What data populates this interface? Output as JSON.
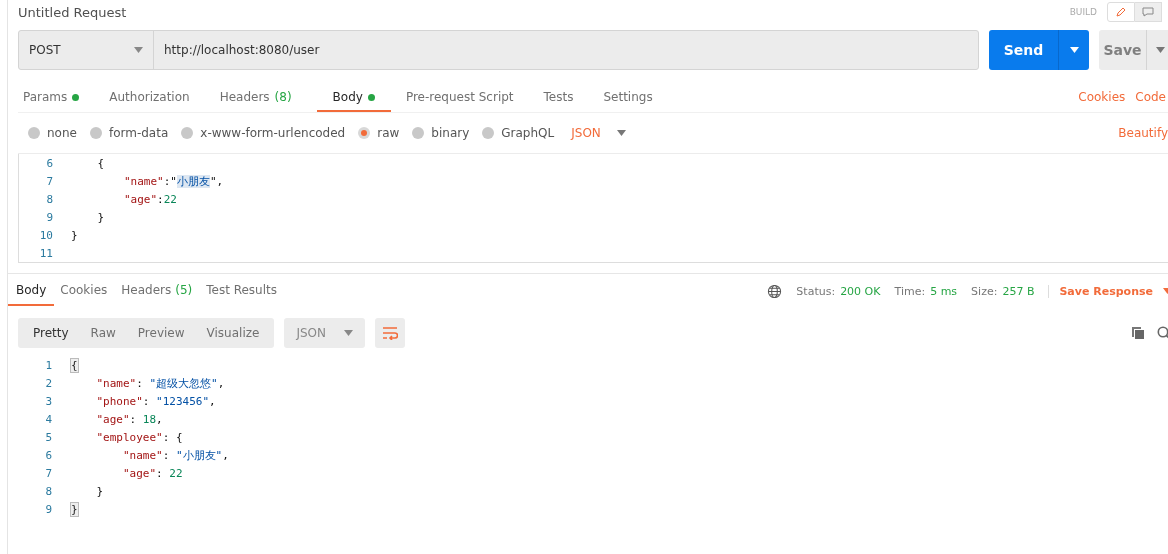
{
  "header": {
    "title": "Untitled Request",
    "mode_label": "BUILD"
  },
  "request": {
    "method": "POST",
    "url": "http://localhost:8080/user",
    "send": "Send",
    "save": "Save"
  },
  "request_tabs": [
    {
      "label": "Params",
      "dot": true,
      "selected": false
    },
    {
      "label": "Authorization",
      "dot": false,
      "selected": false
    },
    {
      "label": "Headers",
      "badge": "(8)",
      "dot": false,
      "selected": false
    },
    {
      "label": "Body",
      "dot": true,
      "selected": true
    },
    {
      "label": "Pre-request Script",
      "dot": false,
      "selected": false
    },
    {
      "label": "Tests",
      "dot": false,
      "selected": false
    },
    {
      "label": "Settings",
      "dot": false,
      "selected": false
    }
  ],
  "request_links": [
    "Cookies",
    "Code"
  ],
  "body_types": [
    {
      "label": "none",
      "selected": false
    },
    {
      "label": "form-data",
      "selected": false
    },
    {
      "label": "x-www-form-urlencoded",
      "selected": false
    },
    {
      "label": "raw",
      "selected": true
    },
    {
      "label": "binary",
      "selected": false
    },
    {
      "label": "GraphQL",
      "selected": false
    }
  ],
  "body_format": "JSON",
  "beautify": "Beautify",
  "request_code": [
    {
      "number": "6",
      "tokens": [
        {
          "kind": "punct",
          "text": "    {"
        }
      ]
    },
    {
      "number": "7",
      "tokens": [
        {
          "kind": "key",
          "text": "        \"name\""
        },
        {
          "kind": "punct",
          "text": ":\""
        },
        {
          "kind": "selected-string",
          "text": "小朋友"
        },
        {
          "kind": "punct",
          "text": "\","
        }
      ]
    },
    {
      "number": "8",
      "tokens": [
        {
          "kind": "key",
          "text": "        \"age\""
        },
        {
          "kind": "punct",
          "text": ":"
        },
        {
          "kind": "number",
          "text": "22"
        }
      ]
    },
    {
      "number": "9",
      "tokens": [
        {
          "kind": "punct",
          "text": "    }"
        }
      ]
    },
    {
      "number": "10",
      "tokens": [
        {
          "kind": "punct",
          "text": "}"
        }
      ]
    },
    {
      "number": "11"
    }
  ],
  "response_tabs": [
    {
      "label": "Body",
      "selected": true
    },
    {
      "label": "Cookies",
      "selected": false
    },
    {
      "label": "Headers",
      "badge": "(5)",
      "selected": false
    },
    {
      "label": "Test Results",
      "selected": false
    }
  ],
  "response_stats": [
    {
      "label": "Status:",
      "value": "200 OK"
    },
    {
      "label": "Time:",
      "value": "5 ms"
    },
    {
      "label": "Size:",
      "value": "257 B"
    }
  ],
  "save_response": "Save Response",
  "view_modes": [
    {
      "label": "Pretty",
      "selected": true
    },
    {
      "label": "Raw",
      "selected": false
    },
    {
      "label": "Preview",
      "selected": false
    },
    {
      "label": "Visualize",
      "selected": false
    }
  ],
  "response_format": "JSON",
  "response_code": [
    {
      "number": "1",
      "tokens": [
        {
          "kind": "matched-bracket",
          "text": "{"
        }
      ]
    },
    {
      "number": "2",
      "tokens": [
        {
          "kind": "key",
          "text": "    \"name\""
        },
        {
          "kind": "punct",
          "text": ": "
        },
        {
          "kind": "string",
          "text": "\"超级大忽悠\""
        },
        {
          "kind": "punct",
          "text": ","
        }
      ]
    },
    {
      "number": "3",
      "tokens": [
        {
          "kind": "key",
          "text": "    \"phone\""
        },
        {
          "kind": "punct",
          "text": ": "
        },
        {
          "kind": "string",
          "text": "\"123456\""
        },
        {
          "kind": "punct",
          "text": ","
        }
      ]
    },
    {
      "number": "4",
      "tokens": [
        {
          "kind": "key",
          "text": "    \"age\""
        },
        {
          "kind": "punct",
          "text": ": "
        },
        {
          "kind": "number",
          "text": "18"
        },
        {
          "kind": "punct",
          "text": ","
        }
      ]
    },
    {
      "number": "5",
      "tokens": [
        {
          "kind": "key",
          "text": "    \"employee\""
        },
        {
          "kind": "punct",
          "text": ": {"
        }
      ]
    },
    {
      "number": "6",
      "tokens": [
        {
          "kind": "key",
          "text": "        \"name\""
        },
        {
          "kind": "punct",
          "text": ": "
        },
        {
          "kind": "string",
          "text": "\"小朋友\""
        },
        {
          "kind": "punct",
          "text": ","
        }
      ]
    },
    {
      "number": "7",
      "tokens": [
        {
          "kind": "key",
          "text": "        \"age\""
        },
        {
          "kind": "punct",
          "text": ": "
        },
        {
          "kind": "number",
          "text": "22"
        }
      ]
    },
    {
      "number": "8",
      "tokens": [
        {
          "kind": "punct",
          "text": "    }"
        }
      ]
    },
    {
      "number": "9",
      "tokens": [
        {
          "kind": "matched-bracket",
          "text": "}"
        }
      ]
    }
  ]
}
